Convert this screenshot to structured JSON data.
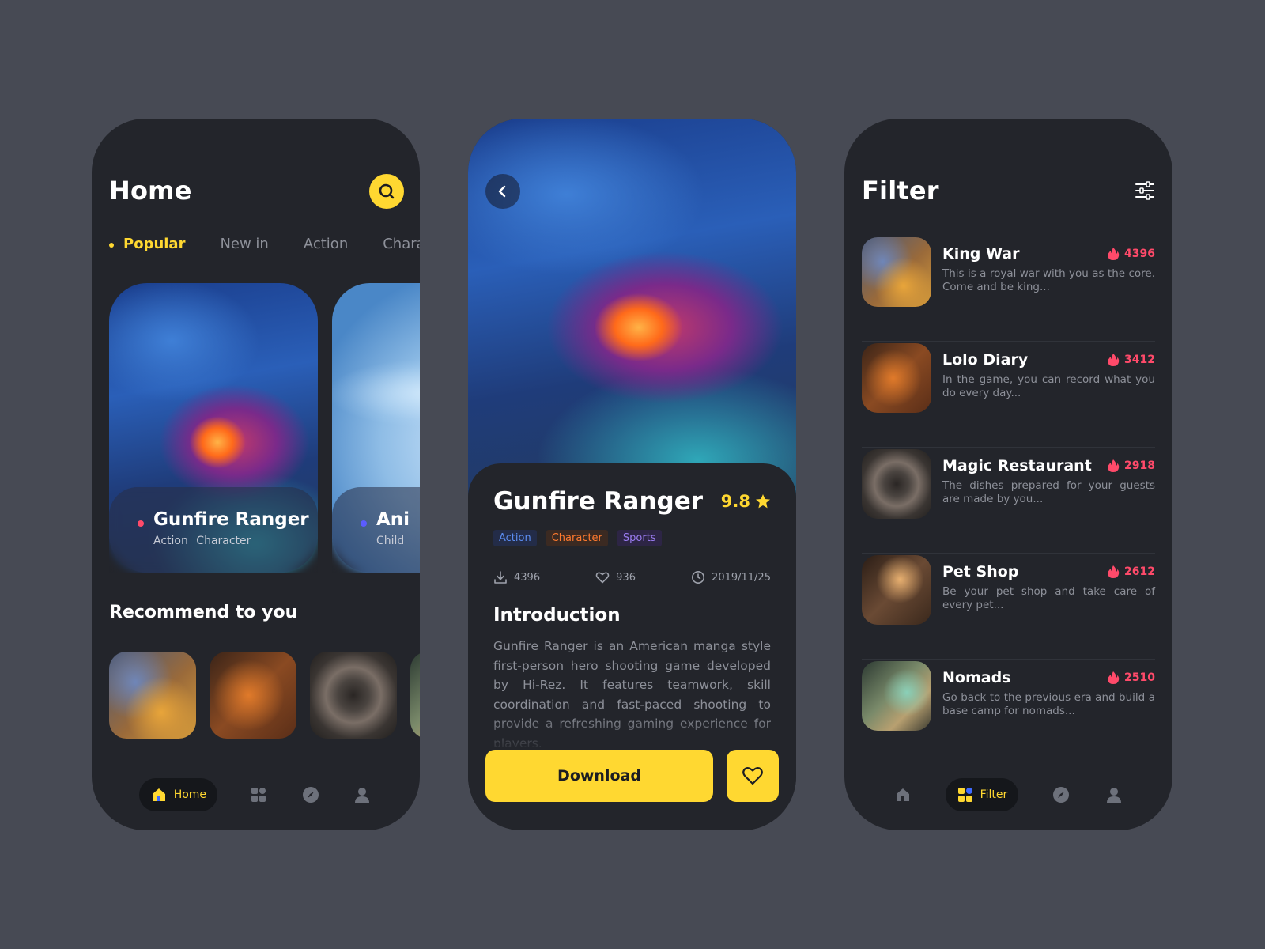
{
  "colors": {
    "background": "#474a54",
    "phone": "#23252b",
    "accent_yellow": "#ffd831",
    "hot_red": "#ff4a6a",
    "muted_text": "#8d9099",
    "tag_blue": "#5b8cf0",
    "tag_orange": "#ff7a2e",
    "tag_purple": "#9a7cf0"
  },
  "home": {
    "title": "Home",
    "search_icon": "search-icon",
    "tabs": [
      "Popular",
      "New in",
      "Action",
      "Character"
    ],
    "featured": [
      {
        "title": "Gunfire Ranger",
        "tags": "Action  Character",
        "dot_color": "#ff4a6a"
      },
      {
        "title": "Ani",
        "tags": "Child",
        "dot_color": "#5b5cff"
      }
    ],
    "recommend_title": "Recommend to you",
    "nav": {
      "home_label": "Home"
    }
  },
  "detail": {
    "title": "Gunfire Ranger",
    "rating": "9.8",
    "tags": [
      "Action",
      "Character",
      "Sports"
    ],
    "downloads": "4396",
    "likes": "936",
    "date": "2019/11/25",
    "intro_title": "Introduction",
    "intro_text": "Gunfire Ranger is an American manga style first-person hero shooting game developed by Hi-Rez. It features teamwork, skill coordination and fast-paced shooting to provide a refreshing gaming experience for players.",
    "download_label": "Download"
  },
  "filter": {
    "title": "Filter",
    "items": [
      {
        "name": "King War",
        "count": "4396",
        "desc": "This is a royal war with you as the core. Come and be king..."
      },
      {
        "name": "Lolo Diary",
        "count": "3412",
        "desc": "In the game, you can record what you do every day..."
      },
      {
        "name": "Magic Restaurant",
        "count": "2918",
        "desc": "The dishes prepared for your guests are made by you..."
      },
      {
        "name": "Pet Shop",
        "count": "2612",
        "desc": "Be your pet shop and take care of every pet..."
      },
      {
        "name": "Nomads",
        "count": "2510",
        "desc": "Go back to the previous era and build a base camp for nomads..."
      }
    ],
    "nav": {
      "filter_label": "Filter"
    }
  }
}
